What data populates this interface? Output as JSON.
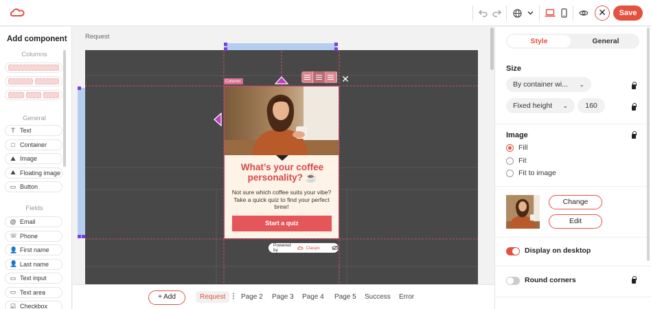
{
  "colors": {
    "accent": "#e4513f",
    "popup_bg": "#fdf3e6",
    "canvas_bg": "#484848",
    "popup_title": "#d8484a"
  },
  "topbar": {
    "icons": [
      "claspo-logo-icon",
      "undo-icon",
      "redo-icon",
      "globe-icon",
      "chevron-down-icon",
      "desktop-icon",
      "mobile-icon",
      "preview-eye-icon",
      "close-icon"
    ],
    "save_label": "Save"
  },
  "left_panel": {
    "title": "Add component",
    "columns_label": "Columns",
    "general_label": "General",
    "general_items": [
      {
        "icon": "text-icon",
        "glyph": "T",
        "label": "Text"
      },
      {
        "icon": "container-icon",
        "glyph": "□",
        "label": "Container"
      },
      {
        "icon": "image-icon",
        "glyph": "⛰",
        "label": "Image"
      },
      {
        "icon": "floating-image-icon",
        "glyph": "⛰",
        "label": "Floating image"
      },
      {
        "icon": "button-icon",
        "glyph": "▭",
        "label": "Button"
      }
    ],
    "fields_label": "Fields",
    "field_items": [
      {
        "icon": "at-icon",
        "glyph": "@",
        "label": "Email"
      },
      {
        "icon": "phone-icon",
        "glyph": "☏",
        "label": "Phone"
      },
      {
        "icon": "user-icon",
        "glyph": "👤",
        "label": "First name"
      },
      {
        "icon": "user-icon",
        "glyph": "👤",
        "label": "Last name"
      },
      {
        "icon": "text-input-icon",
        "glyph": "▭",
        "label": "Text input"
      },
      {
        "icon": "text-area-icon",
        "glyph": "▭",
        "label": "Text area"
      },
      {
        "icon": "checkbox-icon",
        "glyph": "☑",
        "label": "Checkbox"
      }
    ]
  },
  "canvas": {
    "breadcrumb": "Request",
    "column_tag": "Column",
    "popup": {
      "title": "What’s your coffee personality? ☕",
      "text": "Not sure which coffee suits your vibe? Take a quick quiz to find your perfect brew!",
      "button": "Start a quiz"
    },
    "powered_by": "Powered by",
    "brand": "Claspo"
  },
  "bottom_bar": {
    "add_label": "+  Add",
    "pages": [
      "Request",
      "Page 2",
      "Page 3",
      "Page 4",
      "Page 5",
      "Success",
      "Error"
    ],
    "active_page": "Request"
  },
  "right_panel": {
    "tabs": [
      "Style",
      "General"
    ],
    "active_tab": "Style",
    "size_label": "Size",
    "width_select": "By container wi...",
    "height_select": "Fixed height",
    "height_value": "160",
    "image_label": "Image",
    "image_fit_options": [
      "Fill",
      "Fit",
      "Fit to image"
    ],
    "image_fit_selected": "Fill",
    "change_label": "Change",
    "edit_label": "Edit",
    "display_desktop_label": "Display on desktop",
    "display_desktop": true,
    "round_corners_label": "Round corners",
    "round_corners": false
  }
}
